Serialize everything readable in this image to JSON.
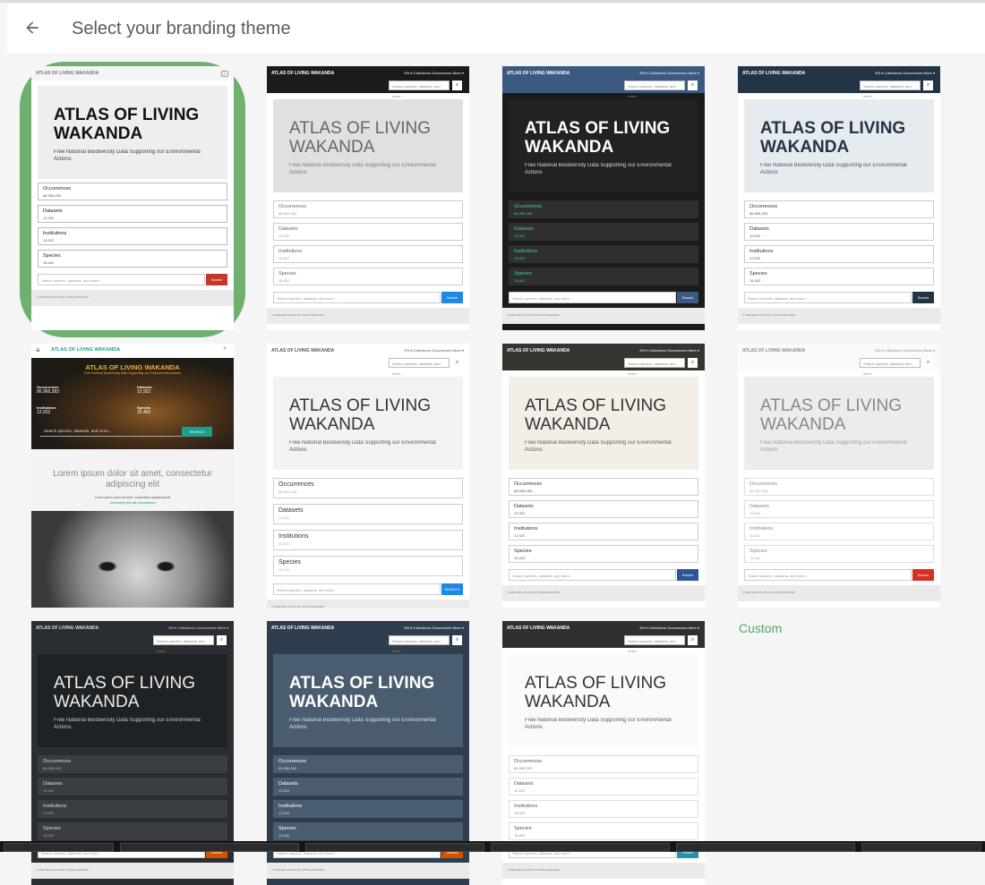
{
  "header": {
    "back_icon": "arrow-left-icon",
    "title": "Select your branding theme"
  },
  "common": {
    "brand": "ATLAS OF LIVING WAKANDA",
    "brand_multiline": "ATLAS OF LIVING WAKANDA",
    "subtitle": "Free National Biodiversity Data Supporting our Environmental Actions",
    "nav": "EN ▾   Collections   Occurrences   More ▾",
    "search_placeholder": "Search species, datasets, and more...",
    "search_button": "Search",
    "search_button_upper": "SEARCH",
    "footer": "© 2020-2021 ATLAS OF LIVING WAKANDA",
    "stats": [
      {
        "label": "Occurrences",
        "value": "86,965,283"
      },
      {
        "label": "Datasets",
        "value": "12,922"
      },
      {
        "label": "Institutions",
        "value": "12,922"
      },
      {
        "label": "Species",
        "value": "15,402"
      }
    ]
  },
  "photo_theme": {
    "menu_icon": "hamburger-icon",
    "brand": "ATLAS OF LIVING WAKANDA",
    "search_icon": "search-icon",
    "hero_title": "ATLAS OF LIVING WAKANDA",
    "hero_sub": "Free National Biodiversity Data Supporting our Environmental Actions",
    "stats": [
      {
        "label": "Occurrences",
        "value": "86,965,283"
      },
      {
        "label": "Datasets",
        "value": "12,922"
      },
      {
        "label": "Institutions",
        "value": "12,922"
      },
      {
        "label": "Species",
        "value": "15,402"
      }
    ],
    "search_placeholder": "Search species, datasets, and more...",
    "search_button": "SEARCH",
    "lorem_title": "Lorem ipsum dolor sit amet, consectetur adipiscing elit",
    "lorem_sub": "Lorem ipsum dolor sit amet, consectetur adipiscing elit",
    "lorem_link": "Just testing this with virtualization"
  },
  "custom_label": "Custom",
  "colors": {
    "selected": "#6fb06f",
    "custom_link": "#55a861"
  }
}
